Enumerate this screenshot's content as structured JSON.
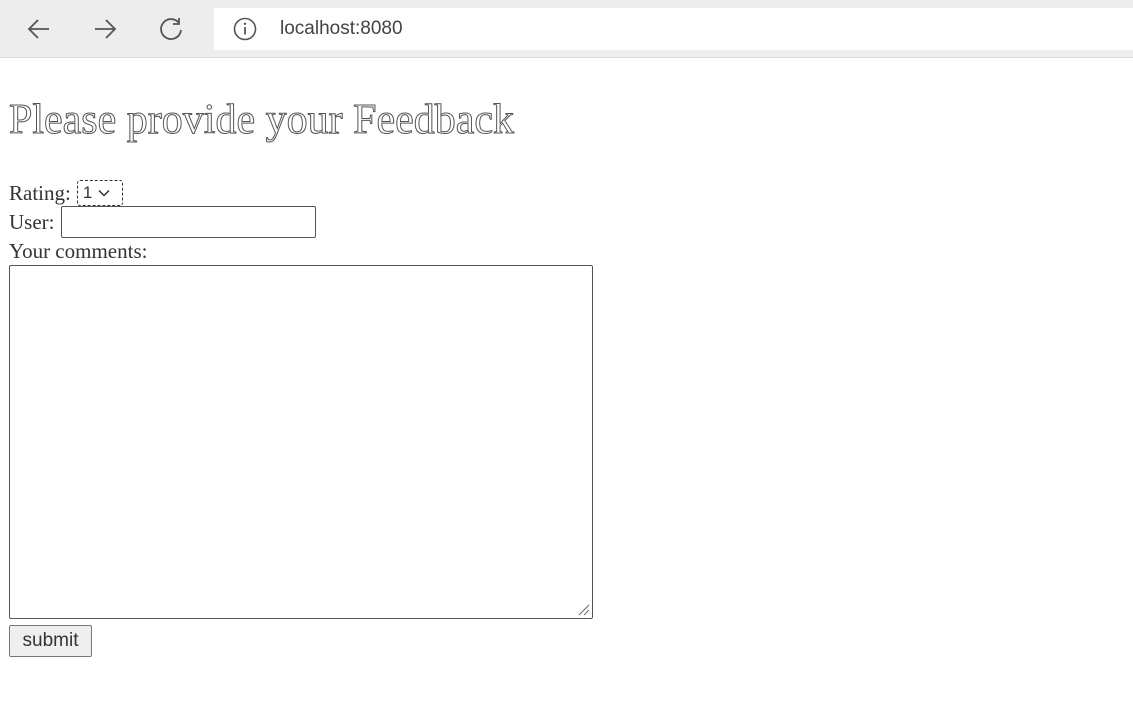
{
  "browser": {
    "url": "localhost:8080",
    "icons": {
      "back": "arrow-left-icon",
      "forward": "arrow-right-icon",
      "reload": "reload-icon",
      "info": "info-icon"
    }
  },
  "form": {
    "title": "Please provide your Feedback",
    "rating_label": "Rating:",
    "rating_value": "1",
    "user_label": "User:",
    "user_value": "",
    "comments_label": "Your comments:",
    "comments_value": "",
    "submit_label": "submit"
  },
  "colors": {
    "toolbar_bg": "#ededed",
    "page_bg": "#ffffff",
    "text": "#333333"
  }
}
